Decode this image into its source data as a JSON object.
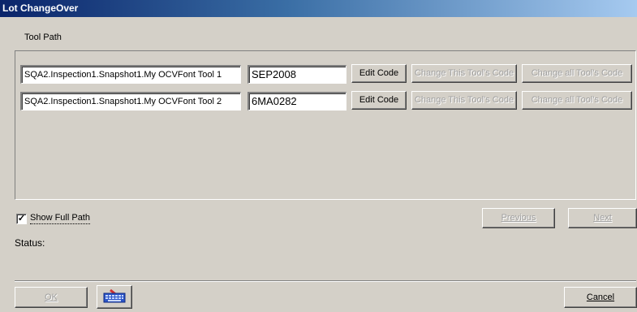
{
  "window": {
    "title": "Lot ChangeOver"
  },
  "tool_path_label": "Tool Path",
  "tools": [
    {
      "path": "SQA2.Inspection1.Snapshot1.My OCVFont Tool 1",
      "code": "SEP2008",
      "edit_label": "Edit Code",
      "change_this_label": "Change This Tool's Code",
      "change_all_label": "Change all Tool's Code"
    },
    {
      "path": "SQA2.Inspection1.Snapshot1.My OCVFont Tool 2",
      "code": "6MA0282",
      "edit_label": "Edit Code",
      "change_this_label": "Change This Tool's Code",
      "change_all_label": "Change all Tool's Code"
    }
  ],
  "show_full_path": {
    "label": "Show Full Path",
    "checked": true,
    "mark": "✓"
  },
  "nav": {
    "previous_label": "Previous",
    "next_label": "Next"
  },
  "status_label": "Status:",
  "footer": {
    "ok_label": "OK",
    "cancel_label": "Cancel",
    "keyboard_icon": "keyboard-icon"
  }
}
